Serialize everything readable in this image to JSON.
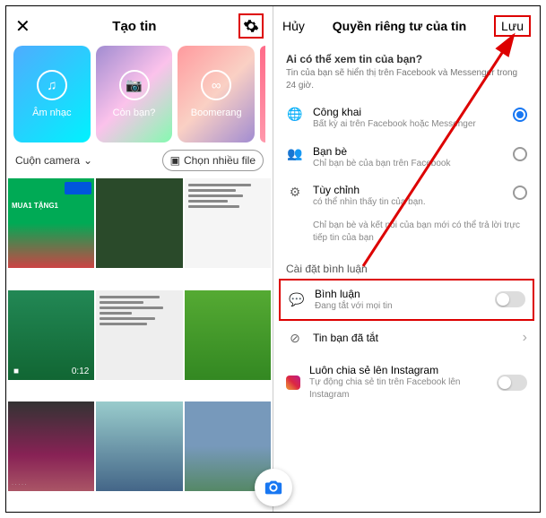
{
  "left": {
    "title": "Tạo tin",
    "cards": [
      {
        "label": "Âm nhạc",
        "icon": "♫"
      },
      {
        "label": "Còn bạn?",
        "icon": "📷"
      },
      {
        "label": "Boomerang",
        "icon": "∞"
      }
    ],
    "roll_label": "Cuộn camera",
    "multi_label": "Chọn nhiều file",
    "promo1": "MUA1 TẶNG1",
    "dur4": "0:12"
  },
  "right": {
    "cancel": "Hủy",
    "title": "Quyền riêng tư của tin",
    "save": "Lưu",
    "who_h": "Ai có thể xem tin của bạn?",
    "who_s": "Tin của bạn sẽ hiển thị trên Facebook và Messenger trong 24 giờ.",
    "opts": [
      {
        "h": "Công khai",
        "s": "Bất kỳ ai trên Facebook hoặc Messenger"
      },
      {
        "h": "Bạn bè",
        "s": "Chỉ bạn bè của bạn trên Facebook"
      },
      {
        "h": "Tùy chỉnh",
        "s": "có thể nhìn thấy tin của bạn."
      }
    ],
    "opt_note": "Chỉ bạn bè và kết nối của bạn mới có thể trả lời trực tiếp tin của bạn",
    "comment_sh": "Cài đặt bình luận",
    "comment_h": "Bình luận",
    "comment_s": "Đang tắt với mọi tin",
    "off_h": "Tin bạn đã tắt",
    "ig_h": "Luôn chia sẻ lên Instagram",
    "ig_s": "Tự động chia sẻ tin trên Facebook lên Instagram"
  }
}
